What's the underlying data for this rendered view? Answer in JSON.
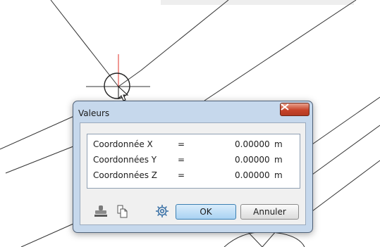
{
  "dialog": {
    "title": "Valeurs",
    "rows": [
      {
        "label": "Coordonnée X",
        "equals": "=",
        "value": "0.00000",
        "unit": "m"
      },
      {
        "label": "Coordonnées Y",
        "equals": "=",
        "value": "0.00000",
        "unit": "m"
      },
      {
        "label": "Coordonnées Z",
        "equals": "=",
        "value": "0.00000",
        "unit": "m"
      }
    ],
    "buttons": {
      "ok": "OK",
      "cancel": "Annuler"
    },
    "icons": [
      "stamp-icon",
      "copy-icon",
      "gear-icon",
      "close-icon"
    ]
  },
  "colors": {
    "dialog_frame": "#c6d8ec",
    "close_button": "#c7442a",
    "ok_button": "#a9d2f2",
    "crosshair_vertical": "#e0302a"
  }
}
